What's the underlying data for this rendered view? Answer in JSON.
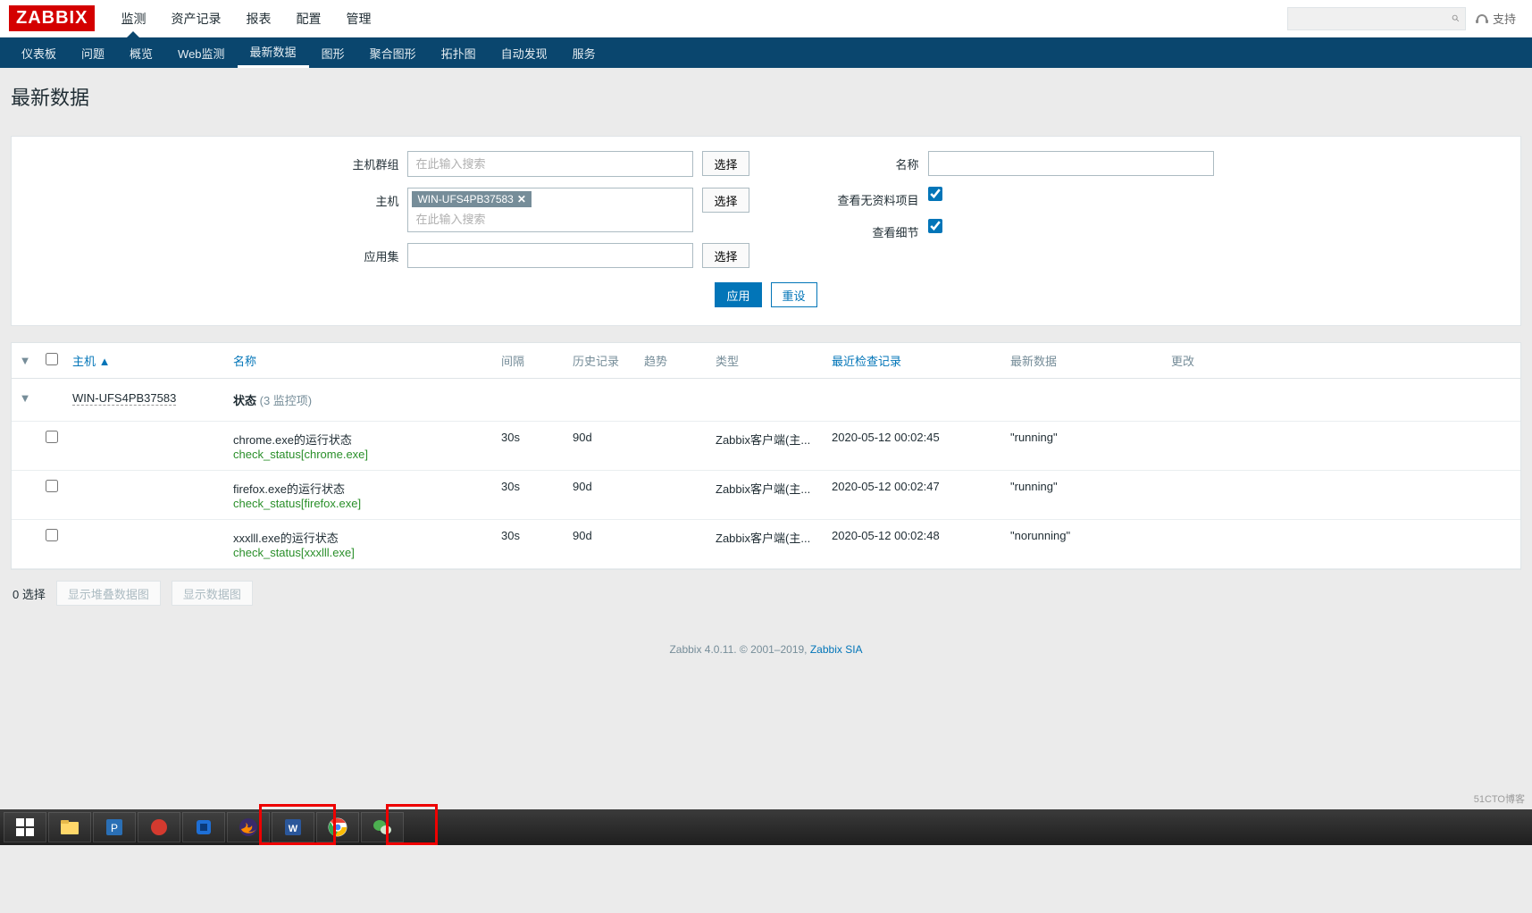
{
  "brand": "ZABBIX",
  "topnav": [
    "监测",
    "资产记录",
    "报表",
    "配置",
    "管理"
  ],
  "topnav_active": 0,
  "support_label": "支持",
  "subnav": [
    "仪表板",
    "问题",
    "概览",
    "Web监测",
    "最新数据",
    "图形",
    "聚合图形",
    "拓扑图",
    "自动发现",
    "服务"
  ],
  "subnav_active": 4,
  "page_title": "最新数据",
  "filter": {
    "labels": {
      "host_group": "主机群组",
      "host": "主机",
      "application": "应用集",
      "name": "名称",
      "show_empty": "查看无资料项目",
      "show_details": "查看细节"
    },
    "placeholder": "在此输入搜索",
    "host_tag": "WIN-UFS4PB37583",
    "select_btn": "选择",
    "apply_btn": "应用",
    "reset_btn": "重设",
    "show_empty_checked": true,
    "show_details_checked": true
  },
  "table": {
    "headers": {
      "host": "主机",
      "name": "名称",
      "interval": "间隔",
      "history": "历史记录",
      "trends": "趋势",
      "type": "类型",
      "last_check": "最近检查记录",
      "last_value": "最新数据",
      "change": "更改"
    },
    "sort_indicator": "▲",
    "host_row": {
      "host": "WIN-UFS4PB37583",
      "app": "状态",
      "app_count": "(3 监控项)"
    },
    "items": [
      {
        "name": "chrome.exe的运行状态",
        "key": "check_status[chrome.exe]",
        "interval": "30s",
        "history": "90d",
        "trends": "",
        "type": "Zabbix客户端(主...",
        "last_check": "2020-05-12 00:02:45",
        "last_value": "\"running\"",
        "change": ""
      },
      {
        "name": "firefox.exe的运行状态",
        "key": "check_status[firefox.exe]",
        "interval": "30s",
        "history": "90d",
        "trends": "",
        "type": "Zabbix客户端(主...",
        "last_check": "2020-05-12 00:02:47",
        "last_value": "\"running\"",
        "change": ""
      },
      {
        "name": "xxxlll.exe的运行状态",
        "key": "check_status[xxxlll.exe]",
        "interval": "30s",
        "history": "90d",
        "trends": "",
        "type": "Zabbix客户端(主...",
        "last_check": "2020-05-12 00:02:48",
        "last_value": "\"norunning\"",
        "change": ""
      }
    ]
  },
  "footer": {
    "selected": "0 选择",
    "stacked_btn": "显示堆叠数据图",
    "graph_btn": "显示数据图"
  },
  "zfooter": {
    "text": "Zabbix 4.0.11. © 2001–2019, ",
    "link": "Zabbix SIA"
  },
  "watermark": "51CTO博客"
}
